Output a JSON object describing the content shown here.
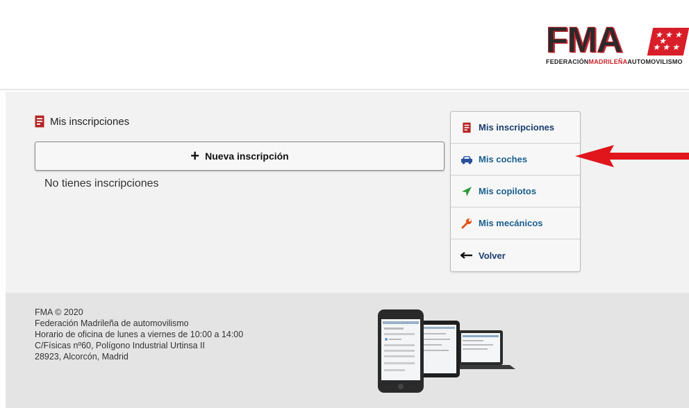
{
  "header": {
    "logo": {
      "letters": "FMA",
      "subtitle_parts": [
        "FEDERACIÓN",
        "MADRILEÑA",
        "AUTOMOVILISMO"
      ]
    }
  },
  "main": {
    "section_title": "Mis inscripciones",
    "new_button_label": "Nueva inscripción",
    "empty_message": "No tienes inscripciones"
  },
  "side_menu": {
    "items": [
      {
        "label": "Mis inscripciones",
        "icon": "document-icon"
      },
      {
        "label": "Mis coches",
        "icon": "car-icon"
      },
      {
        "label": "Mis copilotos",
        "icon": "paper-plane-icon"
      },
      {
        "label": "Mis mecánicos",
        "icon": "wrench-icon"
      },
      {
        "label": "Volver",
        "icon": "arrow-left-icon"
      }
    ]
  },
  "footer": {
    "lines": [
      "FMA © 2020",
      "Federación Madrileña de automovilismo",
      "Horario de oficina de lunes a viernes de 10:00 a 14:00",
      "C/Físicas nº60, Polígono Industrial Urtinsa II",
      "28923, Alcorcón, Madrid"
    ]
  },
  "colors": {
    "brand_red": "#c8202a",
    "menu_text": "#1a3d6d",
    "annotation_arrow": "#e0161c"
  }
}
